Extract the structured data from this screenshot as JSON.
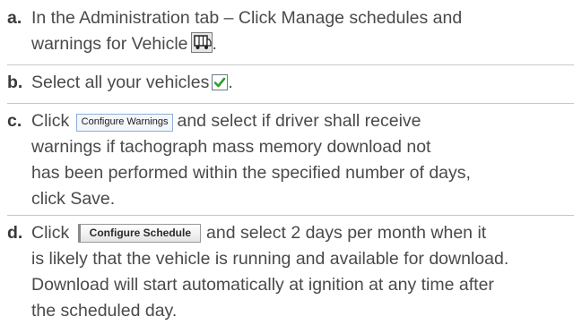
{
  "steps": [
    {
      "letter": "a.",
      "line1": "In the Administration tab – Click Manage schedules and",
      "line2": "warnings for Vehicle",
      "line2_end": ".",
      "icon": "vehicle-icon"
    },
    {
      "letter": "b.",
      "line1": "Select all your vehicles",
      "line1_end": ".",
      "icon": "checkbox-checked-icon",
      "icon_color": "#2e9e2e"
    },
    {
      "letter": "c.",
      "pre": "Click",
      "button": "Configure Warnings",
      "line1": "and select if driver shall receive",
      "line2": "warnings if tachograph mass memory download not",
      "line3": "has been performed within the specified number of days,",
      "line4": "click Save."
    },
    {
      "letter": "d.",
      "pre": "Click",
      "button": "Configure Schedule",
      "line1": "and select 2 days per month when it",
      "line2": "is likely that the vehicle is running and available for download.",
      "line3": "Download will start automatically at ignition at any time after",
      "line4": "the scheduled day."
    }
  ]
}
